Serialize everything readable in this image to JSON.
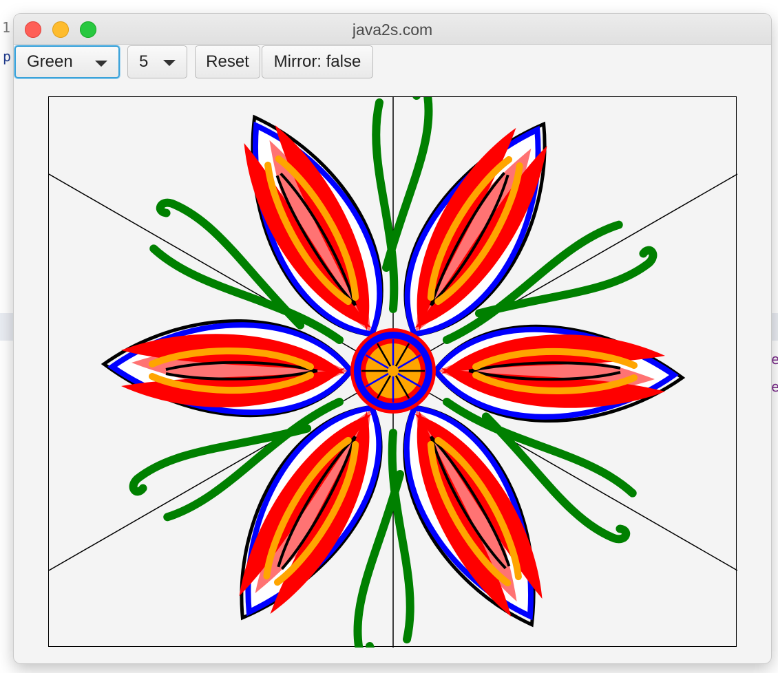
{
  "window": {
    "title": "java2s.com"
  },
  "toolbar": {
    "color_selected": "Green",
    "width_selected": "5",
    "reset_label": "Reset",
    "mirror_label": "Mirror: false"
  },
  "background_fragments": [
    "1",
    "p",
    "e",
    "e"
  ],
  "drawing": {
    "petal_count": 6,
    "stem_count": 6,
    "colors": {
      "petal_fill": "#ff0000",
      "petal_outline_inner": "#0000ff",
      "petal_outline_outer": "#000000",
      "vein": "#ffa500",
      "stem": "#008000",
      "guide_lines": "#000000",
      "canvas_bg": "#f4f4f4"
    }
  }
}
